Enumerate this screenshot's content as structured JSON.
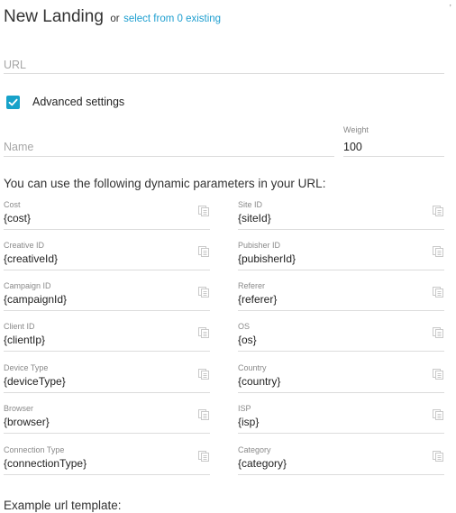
{
  "header": {
    "title": "New Landing",
    "or_text": "or",
    "select_link": "select from 0 existing"
  },
  "url_field": {
    "placeholder": "URL",
    "value": ""
  },
  "advanced": {
    "checked": true,
    "label": "Advanced settings"
  },
  "name_field": {
    "placeholder": "Name",
    "value": ""
  },
  "weight_field": {
    "label": "Weight",
    "value": "100"
  },
  "dynamic": {
    "heading": "You can use the following dynamic parameters in your URL:",
    "params": [
      {
        "label": "Cost",
        "value": "{cost}"
      },
      {
        "label": "Site ID",
        "value": "{siteId}"
      },
      {
        "label": "Creative ID",
        "value": "{creativeId}"
      },
      {
        "label": "Pubisher ID",
        "value": "{pubisherId}"
      },
      {
        "label": "Campaign ID",
        "value": "{campaignId}"
      },
      {
        "label": "Referer",
        "value": "{referer}"
      },
      {
        "label": "Client ID",
        "value": "{clientIp}"
      },
      {
        "label": "OS",
        "value": "{os}"
      },
      {
        "label": "Device Type",
        "value": "{deviceType}"
      },
      {
        "label": "Country",
        "value": "{country}"
      },
      {
        "label": "Browser",
        "value": "{browser}"
      },
      {
        "label": "ISP",
        "value": "{isp}"
      },
      {
        "label": "Connection Type",
        "value": "{connectionType}"
      },
      {
        "label": "Category",
        "value": "{category}"
      }
    ]
  },
  "example": {
    "heading": "Example url template:"
  },
  "icons": {
    "copy": "copy-icon",
    "check": "check-icon"
  },
  "colors": {
    "accent": "#17a2c9",
    "link": "#1f9fd0"
  }
}
